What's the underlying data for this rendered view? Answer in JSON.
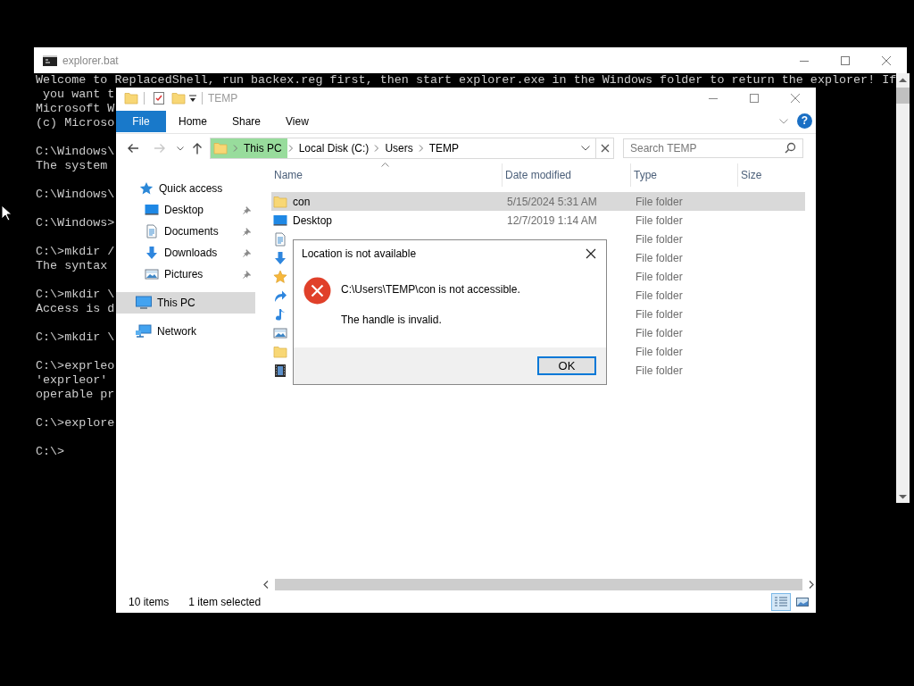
{
  "console": {
    "title": "explorer.bat",
    "blocks": [
      [
        "Welcome to ReplacedShell, run backex.reg first, then start explorer.exe in the Windows folder to return the explorer! If",
        " you want t",
        "Microsoft W",
        "(c) Microso"
      ],
      [
        "C:\\Windows\\",
        "The system"
      ],
      [
        "C:\\Windows\\"
      ],
      [
        "C:\\Windows>"
      ],
      [
        "C:\\>mkdir /",
        "The syntax"
      ],
      [
        "C:\\>mkdir \\",
        "Access is d"
      ],
      [
        "C:\\>mkdir \\"
      ],
      [
        "C:\\>exprleo",
        "'exprleor'",
        "operable pr"
      ],
      [
        "C:\\>explore"
      ],
      [
        "C:\\>"
      ]
    ]
  },
  "explorer": {
    "title": "TEMP",
    "ribbon_tabs": [
      {
        "label": "File",
        "kind": "menu"
      },
      {
        "label": "Home",
        "kind": "tab"
      },
      {
        "label": "Share",
        "kind": "tab"
      },
      {
        "label": "View",
        "kind": "tab"
      }
    ],
    "help": "?",
    "back_enabled": true,
    "forward_enabled": false,
    "address": [
      {
        "label": "This PC",
        "selected": true
      },
      {
        "label": "Local Disk (C:)",
        "selected": false
      },
      {
        "label": "Users",
        "selected": false
      },
      {
        "label": "TEMP",
        "selected": false
      }
    ],
    "search": {
      "placeholder": "Search TEMP"
    },
    "nav": [
      {
        "label": "Quick access",
        "kind": "quick",
        "selected": false,
        "children": [
          {
            "label": "Desktop",
            "kind": "desktop",
            "pinned": true,
            "selected": false
          },
          {
            "label": "Documents",
            "kind": "documents",
            "pinned": true,
            "selected": false
          },
          {
            "label": "Downloads",
            "kind": "downloads",
            "pinned": true,
            "selected": false
          },
          {
            "label": "Pictures",
            "kind": "pictures",
            "pinned": true,
            "selected": false
          }
        ]
      },
      {
        "label": "This PC",
        "kind": "pc",
        "selected": true
      },
      {
        "label": "Network",
        "kind": "network",
        "selected": false
      }
    ],
    "columns": [
      "Name",
      "Date modified",
      "Type",
      "Size"
    ],
    "rows": [
      {
        "kind": "folder",
        "name": "con",
        "date": "5/15/2024 5:31 AM",
        "type": "File folder",
        "selected": true
      },
      {
        "kind": "desktop",
        "name": "Desktop",
        "date": "12/7/2019 1:14 AM",
        "type": "File folder",
        "selected": false
      },
      {
        "kind": "documents",
        "type": "File folder",
        "selected": false
      },
      {
        "kind": "downloads",
        "type": "File folder",
        "selected": false
      },
      {
        "kind": "favorites",
        "type": "File folder",
        "selected": false
      },
      {
        "kind": "links",
        "type": "File folder",
        "selected": false
      },
      {
        "kind": "music",
        "type": "File folder",
        "selected": false
      },
      {
        "kind": "pictures",
        "type": "File folder",
        "selected": false
      },
      {
        "kind": "folder",
        "type": "File folder",
        "selected": false
      },
      {
        "kind": "videos",
        "type": "File folder",
        "selected": false
      }
    ],
    "status": {
      "count": "10 items",
      "selection": "1 item selected"
    },
    "views": [
      {
        "kind": "details",
        "selected": true
      },
      {
        "kind": "large",
        "selected": false
      }
    ]
  },
  "dialog": {
    "title": "Location is not available",
    "message": "C:\\Users\\TEMP\\con is not accessible.",
    "detail": "The handle is invalid.",
    "button": "OK"
  }
}
